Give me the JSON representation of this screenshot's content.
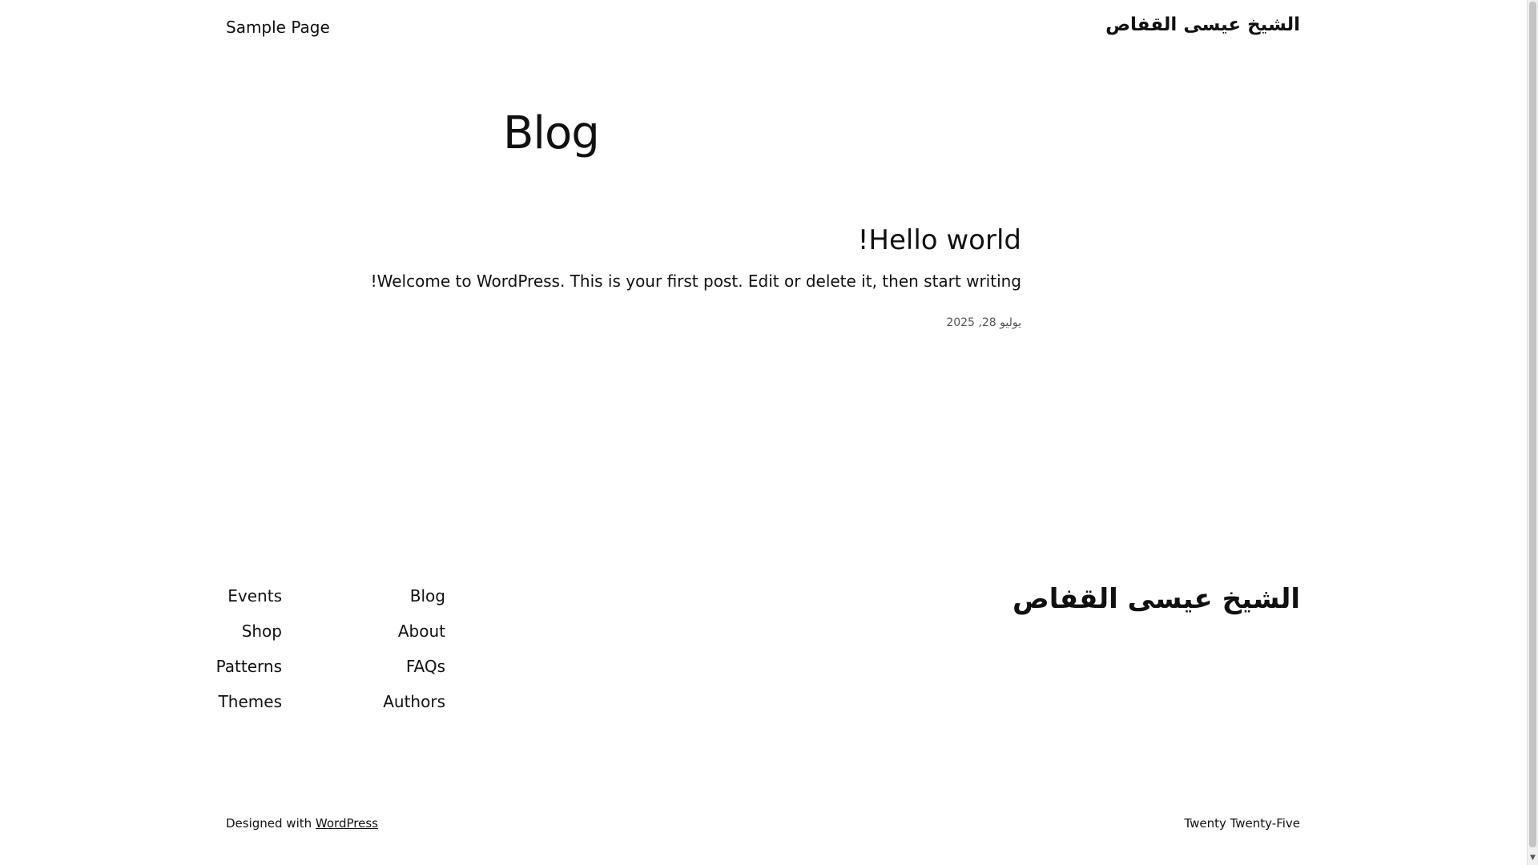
{
  "header": {
    "site_title": "الشيخ عيسى القفاص",
    "nav": [
      "Sample Page"
    ]
  },
  "main": {
    "page_title": "Blog",
    "posts": [
      {
        "title": "Hello world!",
        "excerpt": "Welcome to WordPress. This is your first post. Edit or delete it, then start writing!",
        "date": "يوليو 28, 2025"
      }
    ]
  },
  "footer": {
    "site_title": "الشيخ عيسى القفاص",
    "nav_col_1": [
      "Blog",
      "About",
      "FAQs",
      "Authors"
    ],
    "nav_col_2": [
      "Events",
      "Shop",
      "Patterns",
      "Themes"
    ],
    "credits_prefix": "Designed with",
    "credits_link": "WordPress",
    "theme_name": "Twenty Twenty-Five"
  },
  "icons": {
    "scroll_down": "scroll-down-arrow-icon"
  }
}
